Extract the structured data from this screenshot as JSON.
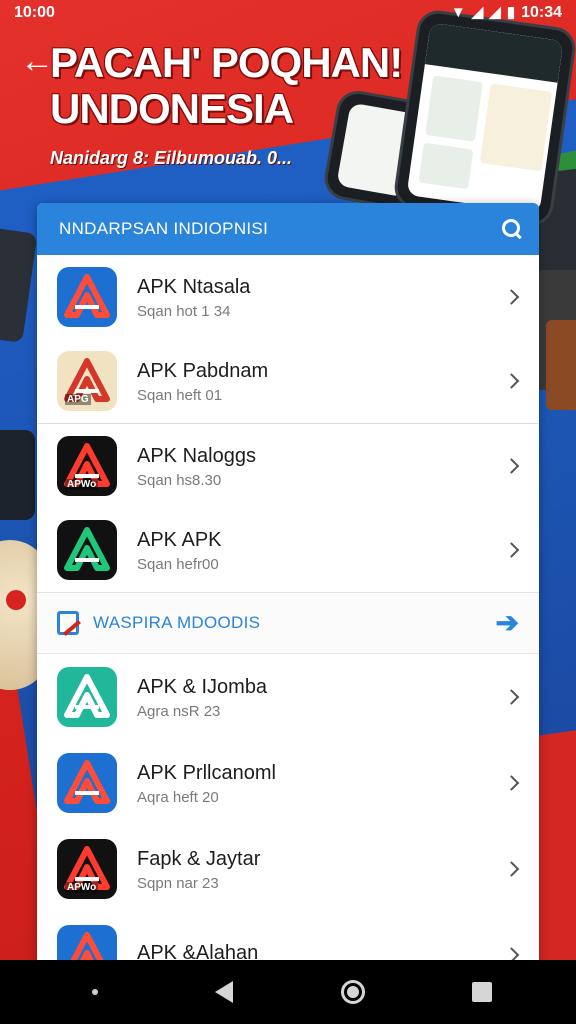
{
  "status_bar": {
    "time": "10:00",
    "right_time": "10:34",
    "icons": [
      "wifi-icon",
      "signal-icon",
      "signal-icon",
      "battery-icon"
    ]
  },
  "header": {
    "back_icon": "back-arrow-icon",
    "title": "PACAH' POQHAN! UNDONESIA",
    "subtitle": "Nanidarg 8: Eilbumouab. 0..."
  },
  "card": {
    "title": "NNDARPSAN INDIOPNISI",
    "search_icon": "search-icon",
    "groups": [
      {
        "items": [
          {
            "name": "APK Ntasala",
            "meta": "Sqan hot 1 34",
            "icon_bg": "#1e6fd2",
            "icon_fg": "#ff4d3a"
          },
          {
            "name": "APK Pabdnam",
            "meta": "Sqan heft 01",
            "icon_bg": "#f1e2c2",
            "icon_fg": "#d2372a",
            "badge": "APG"
          }
        ]
      },
      {
        "items": [
          {
            "name": "APK Naloggs",
            "meta": "Sqan hs8.30",
            "icon_bg": "#111111",
            "icon_fg": "#ff3b30",
            "badge": "APWo"
          },
          {
            "name": "APK APK",
            "meta": "Sqan hefr00",
            "icon_bg": "#111111",
            "icon_fg": "#1ec77a"
          }
        ]
      }
    ],
    "section": {
      "label": "WASPIRA MDOODIS",
      "arrow_icon": "arrow-right-icon"
    },
    "more_items": [
      {
        "name": "APK & IJomba",
        "meta": "Agra nsR 23",
        "icon_bg": "#20b79a",
        "icon_fg": "#ffffff"
      },
      {
        "name": "APK Prllcanoml",
        "meta": "Aqra heft 20",
        "icon_bg": "#1e6fd2",
        "icon_fg": "#ff4d3a"
      },
      {
        "name": "Fapk & Jaytar",
        "meta": "Sqpn nar 23",
        "icon_bg": "#111111",
        "icon_fg": "#ff3b30",
        "badge": "APWo"
      },
      {
        "name": "APK &Alahan",
        "meta": "",
        "icon_bg": "#1e6fd2",
        "icon_fg": "#ff4d3a"
      }
    ]
  },
  "nav_bar": {
    "icons": [
      "dot-icon",
      "back-triangle-icon",
      "home-circle-icon",
      "recents-square-icon"
    ]
  }
}
